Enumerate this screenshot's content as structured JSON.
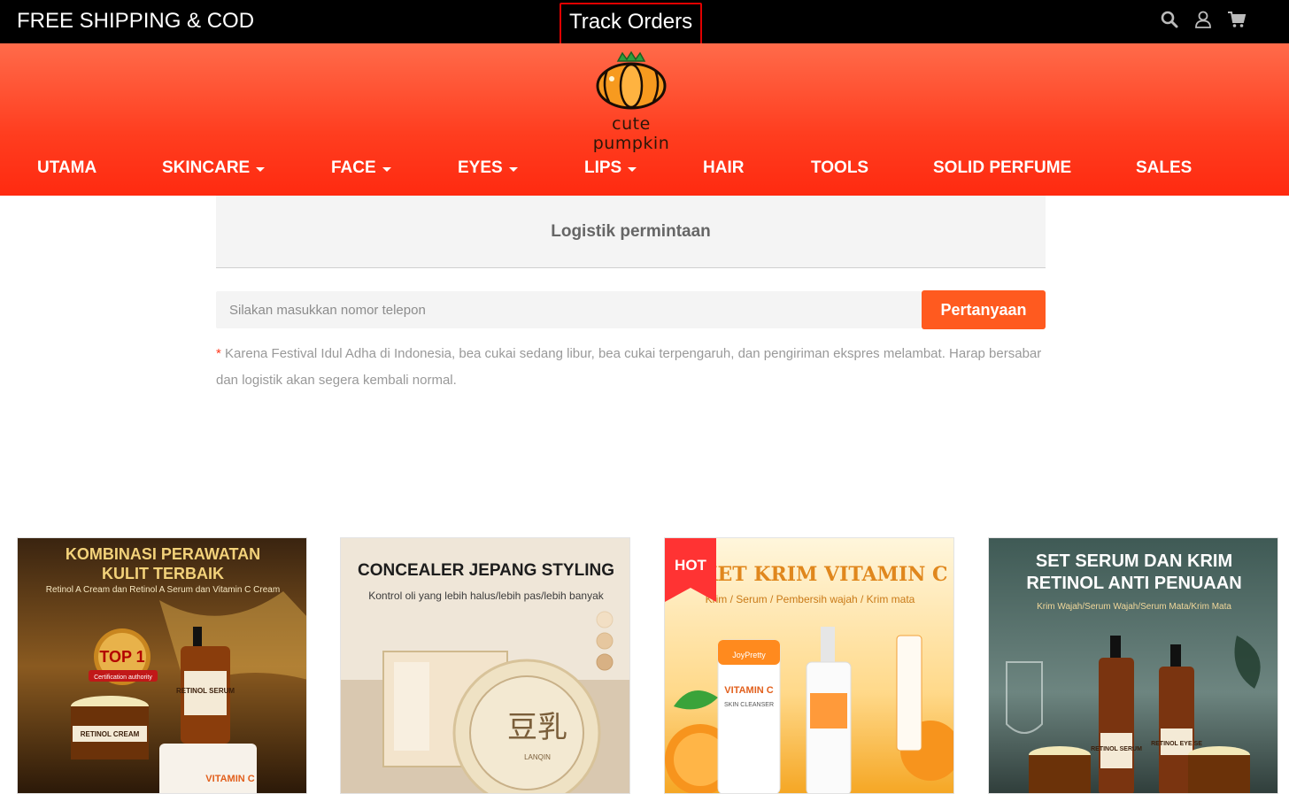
{
  "topbar": {
    "promo": "FREE SHIPPING & COD",
    "track_orders": "Track Orders",
    "icons": [
      "search-icon",
      "user-icon",
      "cart-icon"
    ]
  },
  "brand": {
    "name": "cute pumpkin"
  },
  "nav": {
    "items": [
      {
        "label": "UTAMA",
        "has_dropdown": false
      },
      {
        "label": "SKINCARE",
        "has_dropdown": true
      },
      {
        "label": "FACE",
        "has_dropdown": true
      },
      {
        "label": "EYES",
        "has_dropdown": true
      },
      {
        "label": "LIPS",
        "has_dropdown": true
      },
      {
        "label": "HAIR",
        "has_dropdown": false
      },
      {
        "label": "TOOLS",
        "has_dropdown": false
      },
      {
        "label": "SOLID PERFUME",
        "has_dropdown": false
      },
      {
        "label": "SALES",
        "has_dropdown": false
      }
    ]
  },
  "tracking": {
    "title": "Logistik permintaan",
    "input_value": "",
    "input_placeholder": "Silakan masukkan nomor telepon",
    "button_label": "Pertanyaan",
    "notice_star": "*",
    "notice_text": "Karena Festival Idul Adha di Indonesia, bea cukai sedang libur, bea cukai terpengaruh, dan pengiriman ekspres melambat. Harap bersabar dan logistik akan segera kembali normal."
  },
  "products": [
    {
      "headline_1": "KOMBINASI PERAWATAN",
      "headline_2": "KULIT TERBAIK",
      "subline": "Retinol A Cream dan Retinol A Serum dan Vitamin C Cream",
      "badge": "TOP 1",
      "badge_sub": "Certification authority",
      "label_1": "RETINOL SERUM",
      "label_2": "RETINOL CREAM",
      "label_3": "VITAMIN C"
    },
    {
      "headline_1": "CONCEALER JEPANG STYLING",
      "subline": "Kontrol oli yang lebih halus/lebih pas/lebih banyak",
      "jp_text": "豆乳",
      "jp_sub": "LANQIN"
    },
    {
      "ribbon": "HOT",
      "headline_1": "KET KRIM VITAMIN C",
      "subline": "Krim / Serum / Pembersih wajah / Krim mata",
      "label_1": "VITAMIN C",
      "label_2": "SKIN CLEANSER",
      "label_3": "JoyPretty"
    },
    {
      "headline_1": "SET SERUM DAN KRIM",
      "headline_2": "RETINOL ANTI PENUAAN",
      "subline": "Krim Wajah/Serum Wajah/Serum Mata/Krim Mata",
      "label_1": "RETINOL SERUM",
      "label_2": "RETINOL EYE SE"
    }
  ],
  "colors": {
    "topbar_bg": "#000000",
    "header_red": "#ff3d1f",
    "button_orange": "#ff5a1f",
    "highlight_border": "#e00000"
  }
}
